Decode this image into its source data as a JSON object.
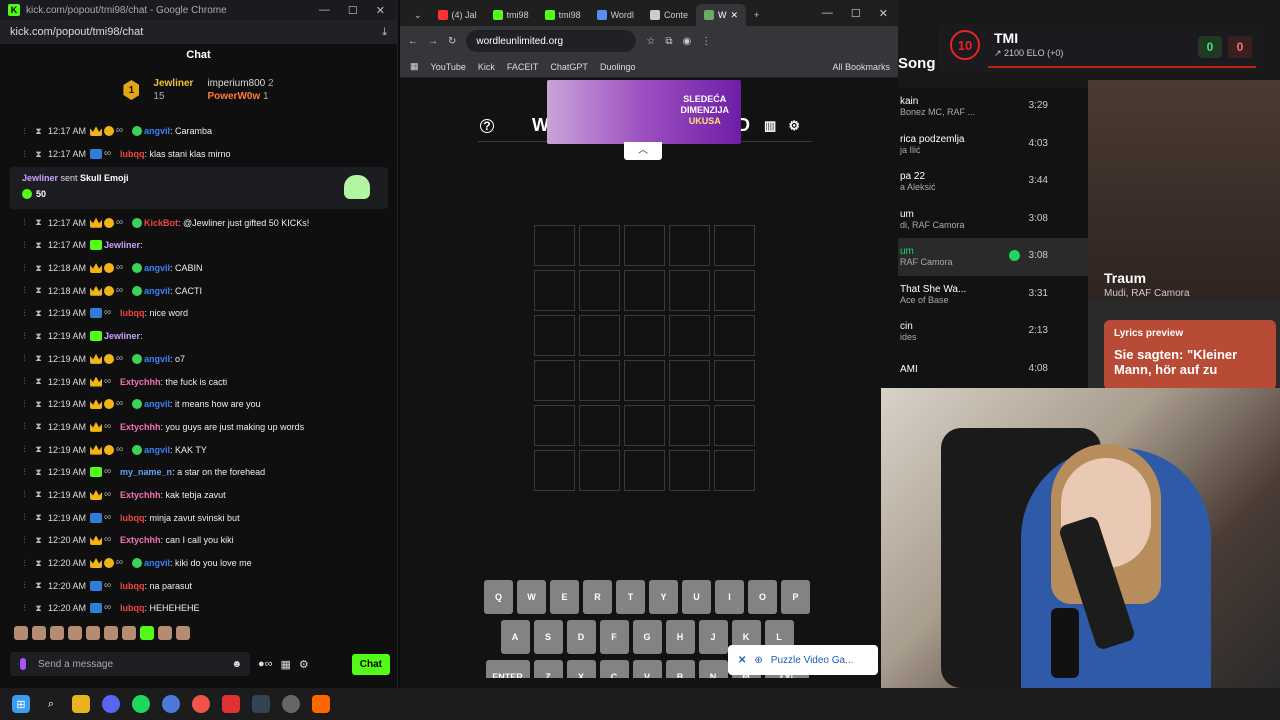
{
  "chat_window": {
    "title": "kick.com/popout/tmi98/chat - Google Chrome",
    "url": "kick.com/popout/tmi98/chat",
    "header": "Chat",
    "leaderboard": {
      "first_name": "Jewliner",
      "first_count": "15",
      "rank": "1",
      "second_name": "imperium800",
      "second_count": "2",
      "third_name": "PowerW0w",
      "third_count": "1"
    },
    "messages": [
      {
        "time": "12:17 AM",
        "user": "angvil",
        "color": "#3b82f6",
        "text": ": Caramba"
      },
      {
        "time": "12:17 AM",
        "user": "lubqq",
        "color": "#ef4444",
        "text": ": klas stani klas mirno"
      },
      {
        "time": "12:17 AM",
        "user": "KickBot",
        "color": "#ef4444",
        "text": ": @Jewliner just gifted 50 KICKs!"
      },
      {
        "time": "12:17 AM",
        "user": "Jewliner",
        "color": "#c9a0ff",
        "text": ":"
      },
      {
        "time": "12:18 AM",
        "user": "angvil",
        "color": "#3b82f6",
        "text": ": CABIN"
      },
      {
        "time": "12:18 AM",
        "user": "angvil",
        "color": "#3b82f6",
        "text": ": CACTI"
      },
      {
        "time": "12:19 AM",
        "user": "lubqq",
        "color": "#ef4444",
        "text": ": nice word"
      },
      {
        "time": "12:19 AM",
        "user": "Jewliner",
        "color": "#c9a0ff",
        "text": ":"
      },
      {
        "time": "12:19 AM",
        "user": "angvil",
        "color": "#3b82f6",
        "text": ": o7"
      },
      {
        "time": "12:19 AM",
        "user": "Extychhh",
        "color": "#f472b6",
        "text": ": the fuck is cacti"
      },
      {
        "time": "12:19 AM",
        "user": "angvil",
        "color": "#3b82f6",
        "text": ": it means how are you"
      },
      {
        "time": "12:19 AM",
        "user": "Extychhh",
        "color": "#f472b6",
        "text": ": you guys are just making up words"
      },
      {
        "time": "12:19 AM",
        "user": "angvil",
        "color": "#3b82f6",
        "text": ": KAK TY"
      },
      {
        "time": "12:19 AM",
        "user": "my_name_n",
        "color": "#60a5fa",
        "text": ": a star on the forehead"
      },
      {
        "time": "12:19 AM",
        "user": "Extychhh",
        "color": "#f472b6",
        "text": ": kak tebja zavut"
      },
      {
        "time": "12:19 AM",
        "user": "lubqq",
        "color": "#ef4444",
        "text": ": minja zavut svinski but"
      },
      {
        "time": "12:20 AM",
        "user": "Extychhh",
        "color": "#f472b6",
        "text": ": can I call you kiki"
      },
      {
        "time": "12:20 AM",
        "user": "angvil",
        "color": "#3b82f6",
        "text": ": kiki do you love me"
      },
      {
        "time": "12:20 AM",
        "user": "lubqq",
        "color": "#ef4444",
        "text": ": na parasut"
      },
      {
        "time": "12:20 AM",
        "user": "lubqq",
        "color": "#ef4444",
        "text": ": HEHEHEHE"
      }
    ],
    "gift": {
      "user": "Jewliner",
      "text": " sent ",
      "item": "Skull Emoji",
      "amount": "50"
    },
    "input_placeholder": "Send a message",
    "send_label": "Chat"
  },
  "browser": {
    "tabs": [
      "(4) Jal",
      "tmi98",
      "tmi98",
      "Wordl",
      "Conte",
      "W"
    ],
    "url": "wordleunlimited.org",
    "bookmarks": [
      "YouTube",
      "Kick",
      "FACEIT",
      "ChatGPT",
      "Duolingo"
    ],
    "all_bookmarks": "All Bookmarks"
  },
  "wordle": {
    "title_left": "W",
    "title_right": "D",
    "ad_line1": "SLEDEĆA",
    "ad_line2": "DIMENZIJA",
    "ad_line3": "UKUSA",
    "keyboard_row1": [
      "Q",
      "W",
      "E",
      "R",
      "T",
      "Y",
      "U",
      "I",
      "O",
      "P"
    ],
    "keyboard_row2": [
      "A",
      "S",
      "D",
      "F",
      "G",
      "H",
      "J",
      "K",
      "L"
    ],
    "keyboard_row3": [
      "ENTER",
      "Z",
      "X",
      "C",
      "V",
      "B",
      "N",
      "M",
      "⌫"
    ],
    "toast": "Puzzle Video Ga..."
  },
  "spotify": {
    "heading": "Song",
    "songs": [
      {
        "title": "kain",
        "artist": "Bonez MC, RAF ...",
        "dur": "3:29"
      },
      {
        "title": "rica podzemlja",
        "artist": "ja Ilić",
        "dur": "4:03"
      },
      {
        "title": "pa 22",
        "artist": "a Aleksić",
        "dur": "3:44"
      },
      {
        "title": "um",
        "artist": "di, RAF Camora",
        "dur": "3:08"
      },
      {
        "title": "um",
        "artist": "RAF Camora",
        "dur": "3:08"
      },
      {
        "title": "That She Wa...",
        "artist": "Ace of Base",
        "dur": "3:31"
      },
      {
        "title": "cin",
        "artist": "ides",
        "dur": "2:13"
      },
      {
        "title": "AMI",
        "artist": "",
        "dur": "4:08"
      }
    ],
    "now_playing_title": "Traum",
    "now_playing_artist": "Mudi, RAF Camora",
    "lyrics_header": "Lyrics preview",
    "lyrics_text": "Sie sagten: \"Kleiner Mann, hör auf zu"
  },
  "overlay": {
    "level": "10",
    "name": "TMI",
    "elo": "↗ 2100 ELO (+0)",
    "wins": "0",
    "losses": "0"
  }
}
